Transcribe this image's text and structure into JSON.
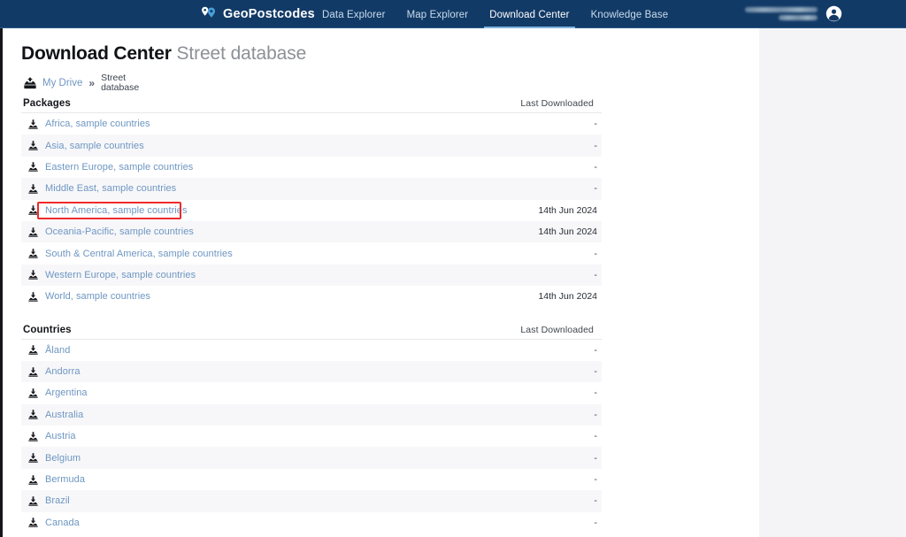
{
  "navbar": {
    "brand_name": "GeoPostcodes",
    "brand_logo_icon": "geopostcodes-pin-logo-icon",
    "tabs": [
      {
        "label": "Data Explorer",
        "active": false
      },
      {
        "label": "Map Explorer",
        "active": false
      },
      {
        "label": "Download Center",
        "active": true
      },
      {
        "label": "Knowledge Base",
        "active": false
      }
    ],
    "user": {
      "name_redacted": true,
      "avatar_icon": "user-account-icon"
    },
    "colors": {
      "background": "#123a66",
      "active_underline": "#7fb5e0",
      "tab_text": "#c9dcec"
    }
  },
  "header": {
    "title_strong": "Download Center",
    "title_light": "Street database"
  },
  "breadcrumb": {
    "drive_icon": "my-drive-tray-icon",
    "root_label": "My Drive",
    "separator": "»",
    "current_label": "Street database"
  },
  "packages_section": {
    "title": "Packages",
    "column_header": "Last Downloaded",
    "rows": [
      {
        "label": "Africa, sample countries",
        "last_downloaded": "-",
        "highlighted": false
      },
      {
        "label": "Asia, sample countries",
        "last_downloaded": "-",
        "highlighted": false
      },
      {
        "label": "Eastern Europe, sample countries",
        "last_downloaded": "-",
        "highlighted": false
      },
      {
        "label": "Middle East, sample countries",
        "last_downloaded": "-",
        "highlighted": false
      },
      {
        "label": "North America, sample countries",
        "last_downloaded": "14th Jun 2024",
        "highlighted": true
      },
      {
        "label": "Oceania-Pacific, sample countries",
        "last_downloaded": "14th Jun 2024",
        "highlighted": false
      },
      {
        "label": "South & Central America, sample countries",
        "last_downloaded": "-",
        "highlighted": false
      },
      {
        "label": "Western Europe, sample countries",
        "last_downloaded": "-",
        "highlighted": false
      },
      {
        "label": "World, sample countries",
        "last_downloaded": "14th Jun 2024",
        "highlighted": false
      }
    ]
  },
  "countries_section": {
    "title": "Countries",
    "column_header": "Last Downloaded",
    "rows": [
      {
        "label": "Åland",
        "last_downloaded": "-"
      },
      {
        "label": "Andorra",
        "last_downloaded": "-"
      },
      {
        "label": "Argentina",
        "last_downloaded": "-"
      },
      {
        "label": "Australia",
        "last_downloaded": "-"
      },
      {
        "label": "Austria",
        "last_downloaded": "-"
      },
      {
        "label": "Belgium",
        "last_downloaded": "-"
      },
      {
        "label": "Bermuda",
        "last_downloaded": "-"
      },
      {
        "label": "Brazil",
        "last_downloaded": "-"
      },
      {
        "label": "Canada",
        "last_downloaded": "-"
      }
    ]
  },
  "annotation": {
    "highlight_color": "#ee2b2b",
    "highlight_target": "North America, sample countries"
  },
  "theme": {
    "link_color": "#6e96c2",
    "row_alt_background": "#f7f7f9",
    "page_background": "#f4f4f6",
    "sheet_background": "#ffffff"
  },
  "icons": {
    "download": "download-tray-icon"
  }
}
